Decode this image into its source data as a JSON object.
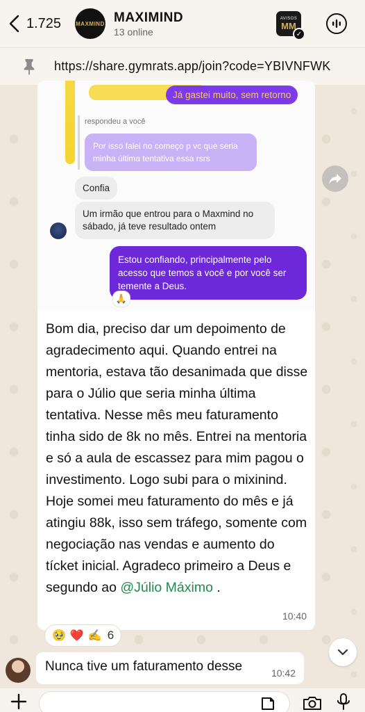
{
  "header": {
    "back_count": "1.725",
    "group_name": "MAXIMIND",
    "online_status": "13 online",
    "avatar_text": "MAXMIND",
    "channel_label": "AVISOS",
    "channel_logo": "MM"
  },
  "pinned": {
    "url": "https://share.gymrats.app/join?code=YBIVNFWK"
  },
  "screenshot": {
    "top_reply": "Já gastei muito, sem retorno",
    "replied_label": "respondeu a você",
    "quoted_text": "Por isso falei no começo p vc que seria minha última tentativa essa rsrs",
    "confia": "Confia",
    "irmao": "Um irmão que entrou para o Maxmind no sábado, já teve resultado ontem",
    "confiando": "Estou confiando, principalmente pelo acesso que temos a você e por você ser temente a Deus.",
    "pray_reaction": "🙏"
  },
  "message": {
    "body": "Bom dia, preciso dar um depoimento de agradecimento aqui. Quando entrei na mentoria, estava tão desanimada que disse para o Júlio que seria minha última tentativa. Nesse mês meu faturamento tinha sido de 8k no mês. Entrei na mentoria e só a aula de escassez  para mim pagou o investimento. Logo subi para o mixinind. Hoje somei meu faturamento do mês e já atingiu 88k, isso sem tráfego, somente com negociação nas vendas e aumento do tícket inicial. Agradeco primeiro a Deus e segundo ao ",
    "mention": "@Júlio Máximo",
    "end": " .",
    "time": "10:40"
  },
  "reactions": {
    "emojis": [
      "🥹",
      "❤️",
      "✍️"
    ],
    "count": "6"
  },
  "message2": {
    "text": "Nunca tive um faturamento desse",
    "time": "10:42"
  },
  "icons": {
    "back": "chevron-left-icon",
    "poll": "poll-icon",
    "pin": "pin-icon",
    "forward": "forward-icon",
    "scroll_down": "chevron-down-icon",
    "plus": "plus-icon",
    "sticker": "sticker-icon",
    "camera": "camera-icon",
    "mic": "microphone-icon"
  }
}
